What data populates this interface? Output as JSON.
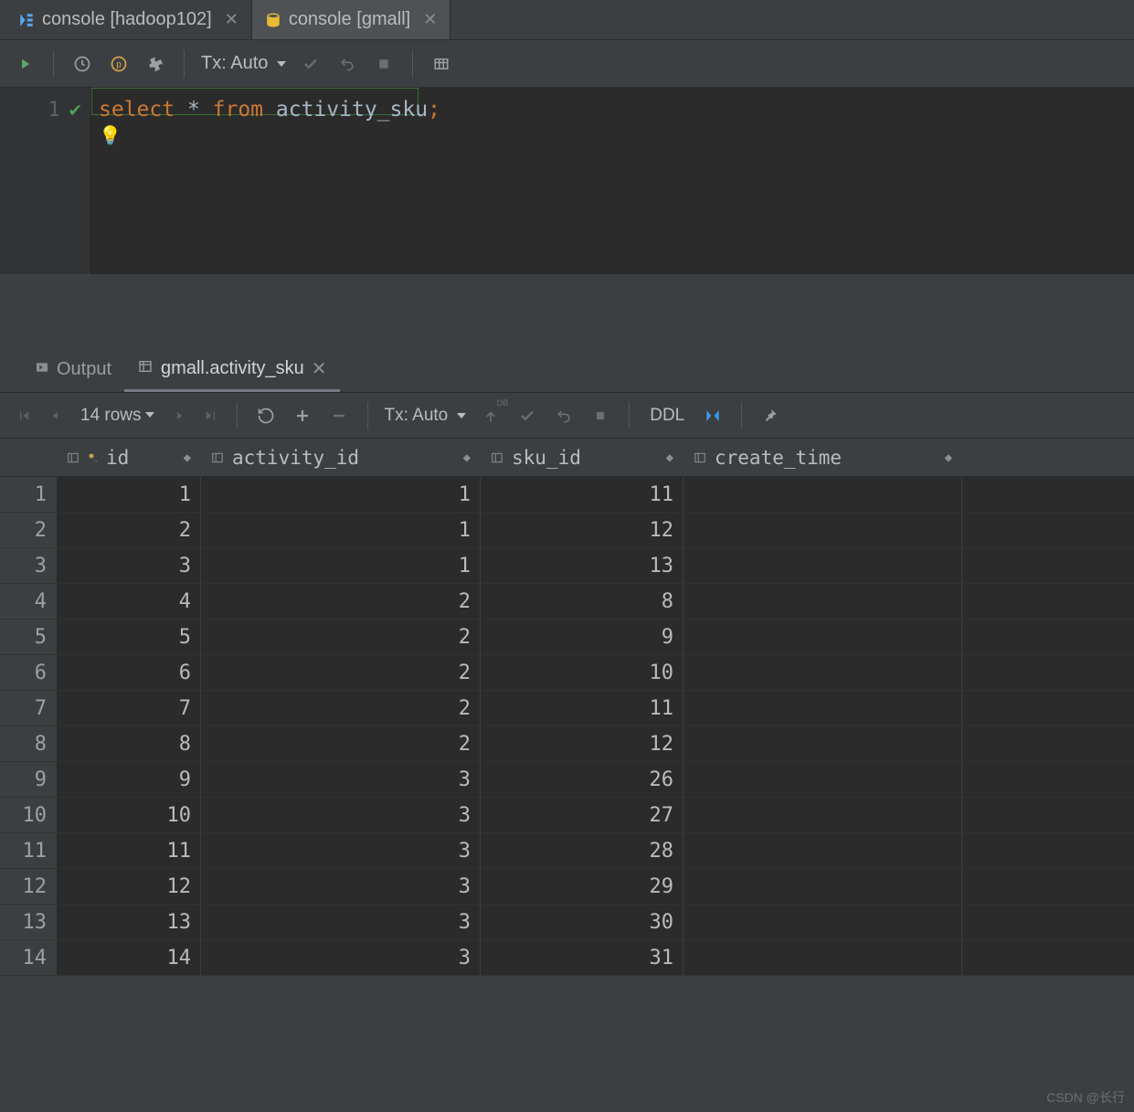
{
  "tabs": [
    {
      "label": "console [hadoop102]",
      "active": false
    },
    {
      "label": "console [gmall]",
      "active": true
    }
  ],
  "editor_toolbar": {
    "tx_label": "Tx: Auto"
  },
  "editor": {
    "line_number": "1",
    "sql": {
      "k1": "select",
      "star": " * ",
      "k2": "from",
      "space": " ",
      "ident": "activity_sku",
      "semi": ";"
    }
  },
  "results": {
    "tabs": [
      {
        "label": "Output",
        "active": false
      },
      {
        "label": "gmall.activity_sku",
        "active": true
      }
    ],
    "toolbar": {
      "rows_label": "14 rows",
      "tx_label": "Tx: Auto",
      "ddl_label": "DDL"
    },
    "columns": [
      {
        "key": "id",
        "label": "id",
        "primary": true
      },
      {
        "key": "activity_id",
        "label": "activity_id",
        "primary": false
      },
      {
        "key": "sku_id",
        "label": "sku_id",
        "primary": false
      },
      {
        "key": "create_time",
        "label": "create_time",
        "primary": false
      }
    ],
    "rows": [
      {
        "n": "1",
        "id": "1",
        "activity_id": "1",
        "sku_id": "11",
        "create_time": "<null>"
      },
      {
        "n": "2",
        "id": "2",
        "activity_id": "1",
        "sku_id": "12",
        "create_time": "<null>"
      },
      {
        "n": "3",
        "id": "3",
        "activity_id": "1",
        "sku_id": "13",
        "create_time": "<null>"
      },
      {
        "n": "4",
        "id": "4",
        "activity_id": "2",
        "sku_id": "8",
        "create_time": "<null>"
      },
      {
        "n": "5",
        "id": "5",
        "activity_id": "2",
        "sku_id": "9",
        "create_time": "<null>"
      },
      {
        "n": "6",
        "id": "6",
        "activity_id": "2",
        "sku_id": "10",
        "create_time": "<null>"
      },
      {
        "n": "7",
        "id": "7",
        "activity_id": "2",
        "sku_id": "11",
        "create_time": "<null>"
      },
      {
        "n": "8",
        "id": "8",
        "activity_id": "2",
        "sku_id": "12",
        "create_time": "<null>"
      },
      {
        "n": "9",
        "id": "9",
        "activity_id": "3",
        "sku_id": "26",
        "create_time": "<null>"
      },
      {
        "n": "10",
        "id": "10",
        "activity_id": "3",
        "sku_id": "27",
        "create_time": "<null>"
      },
      {
        "n": "11",
        "id": "11",
        "activity_id": "3",
        "sku_id": "28",
        "create_time": "<null>"
      },
      {
        "n": "12",
        "id": "12",
        "activity_id": "3",
        "sku_id": "29",
        "create_time": "<null>"
      },
      {
        "n": "13",
        "id": "13",
        "activity_id": "3",
        "sku_id": "30",
        "create_time": "<null>"
      },
      {
        "n": "14",
        "id": "14",
        "activity_id": "3",
        "sku_id": "31",
        "create_time": "<null>"
      }
    ]
  },
  "watermark": "CSDN @长行"
}
